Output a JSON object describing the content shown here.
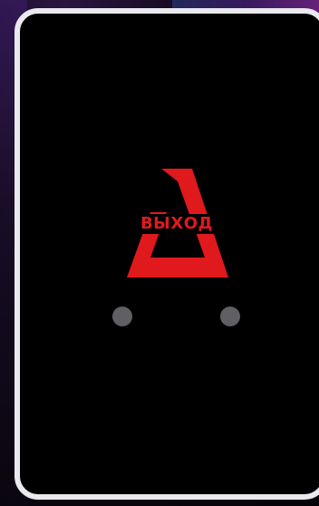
{
  "logo": {
    "text": "ВЫХОД",
    "icon": "triangle-exit-icon",
    "color": "#e0191c"
  },
  "card": {
    "background": "#000000",
    "border_color": "#e9e9ee"
  },
  "indicators": {
    "color": "#5f5f64",
    "count": 2
  }
}
